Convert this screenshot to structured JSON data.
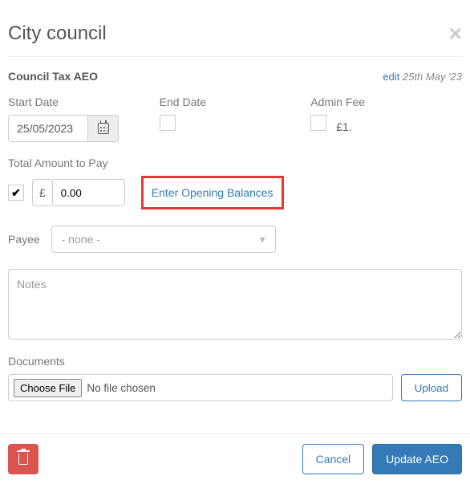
{
  "header": {
    "title": "City council"
  },
  "aeo": {
    "type_label": "Council Tax AEO",
    "edit_label": "edit",
    "last_edited": "25th May '23"
  },
  "fields": {
    "start_date": {
      "label": "Start Date",
      "value": "25/05/2023"
    },
    "end_date": {
      "label": "End Date",
      "checked": false
    },
    "admin_fee": {
      "label": "Admin Fee",
      "checked": false,
      "value_text": "£1."
    },
    "total_amount": {
      "label": "Total Amount to Pay",
      "enabled": true,
      "currency_symbol": "£",
      "value": "0.00"
    },
    "opening_balances_link": "Enter Opening Balances",
    "payee": {
      "label": "Payee",
      "selected": "- none -"
    },
    "notes": {
      "placeholder": "Notes",
      "value": ""
    },
    "documents": {
      "label": "Documents",
      "choose_label": "Choose File",
      "status": "No file chosen",
      "upload_label": "Upload"
    }
  },
  "footer": {
    "cancel_label": "Cancel",
    "submit_label": "Update AEO"
  }
}
